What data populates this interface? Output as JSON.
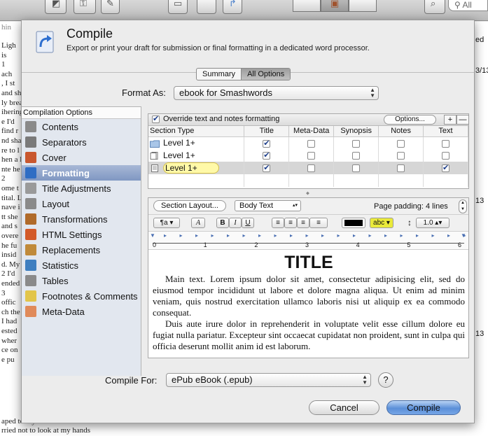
{
  "background": {
    "search_text": "All",
    "left_col_label": "hin",
    "left_lines": [
      "Ligh",
      "is",
      "1",
      "ach",
      ", I st",
      "and sh",
      "ly brea",
      "ihering",
      "e I'd",
      "find r",
      "nd sha",
      "re to l",
      "hen a l",
      "nte he",
      "2",
      "ome t",
      "tital. L",
      "nave i",
      "tt she",
      "and s",
      "overe",
      "he fu",
      "insid",
      "d. My",
      "2 I'd",
      "ended",
      "3",
      "offic",
      "ch the",
      "I had",
      "ested",
      "wher",
      "ce on",
      "e pu"
    ],
    "right_lines": [
      "ed",
      "3/13",
      "13",
      "13"
    ],
    "bottom_lines": [
      "aped to my face I didn't even know",
      "rried not to look at my hands"
    ]
  },
  "sheet": {
    "title": "Compile",
    "subtitle": "Export or print your draft for submission or final formatting in a dedicated word processor.",
    "mode_tabs": [
      {
        "label": "Summary",
        "selected": false
      },
      {
        "label": "All Options",
        "selected": true
      }
    ],
    "format_as_label": "Format As:",
    "format_as_value": "ebook for Smashwords"
  },
  "sidebar": {
    "header": "Compilation Options",
    "items": [
      {
        "label": "Contents",
        "icon": "list-icon",
        "color": "#8a8a8a"
      },
      {
        "label": "Separators",
        "icon": "separators-icon",
        "color": "#7a7a7a"
      },
      {
        "label": "Cover",
        "icon": "cover-icon",
        "color": "#c9572e"
      },
      {
        "label": "Formatting",
        "icon": "formatting-icon",
        "color": "#2f6dc4",
        "selected": true
      },
      {
        "label": "Title Adjustments",
        "icon": "title-adjust-icon",
        "color": "#9a9a9a"
      },
      {
        "label": "Layout",
        "icon": "layout-icon",
        "color": "#8a8a8a"
      },
      {
        "label": "Transformations",
        "icon": "transformations-icon",
        "color": "#b06a2a"
      },
      {
        "label": "HTML Settings",
        "icon": "html-icon",
        "color": "#d35a2a"
      },
      {
        "label": "Replacements",
        "icon": "replacements-icon",
        "color": "#c08a3a"
      },
      {
        "label": "Statistics",
        "icon": "statistics-icon",
        "color": "#3f7fc0"
      },
      {
        "label": "Tables",
        "icon": "tables-icon",
        "color": "#8a8a8a"
      },
      {
        "label": "Footnotes & Comments",
        "icon": "footnotes-icon",
        "color": "#e2c54a"
      },
      {
        "label": "Meta-Data",
        "icon": "tag-icon",
        "color": "#e08a5a"
      }
    ]
  },
  "options": {
    "override_label": "Override text and notes formatting",
    "override_checked": true,
    "options_button": "Options...",
    "plus_label": "+",
    "minus_label": "—",
    "columns": [
      "Section Type",
      "Title",
      "Meta-Data",
      "Synopsis",
      "Notes",
      "Text"
    ],
    "rows": [
      {
        "name": "Level  1+",
        "icon": "folder-icon",
        "title": true,
        "meta": false,
        "synopsis": false,
        "notes": false,
        "text": false,
        "selected": false
      },
      {
        "name": "Level  1+",
        "icon": "doc-stack-icon",
        "title": true,
        "meta": false,
        "synopsis": false,
        "notes": false,
        "text": false,
        "selected": false
      },
      {
        "name": "Level  1+",
        "icon": "document-icon",
        "title": true,
        "meta": false,
        "synopsis": false,
        "notes": false,
        "text": true,
        "selected": true
      }
    ]
  },
  "editor": {
    "section_layout_button": "Section Layout...",
    "style_popup": "Body Text",
    "page_padding": "Page padding: 4 lines",
    "paragraph_button": "¶a",
    "font_button": "A",
    "bold": "B",
    "italic": "I",
    "underline": "U",
    "highlight_label": "abc",
    "line_spacing": "1.0",
    "ruler_numbers": [
      "0",
      "1",
      "2",
      "3",
      "4",
      "5",
      "6"
    ],
    "doc_title": "TITLE",
    "paragraph1": "Main text. Lorem ipsum dolor sit amet, consectetur adipisicing elit, sed do eiusmod tempor incididunt ut labore et dolore magna aliqua. Ut enim ad minim veniam, quis nostrud exercitation ullamco laboris nisi ut aliquip ex ea commodo consequat.",
    "paragraph2": "Duis aute irure dolor in reprehenderit in voluptate velit esse cillum dolore eu fugiat nulla pariatur. Excepteur sint occaecat cupidatat non proident, sunt in culpa qui officia deserunt mollit anim id est laborum."
  },
  "footer": {
    "compile_for_label": "Compile For:",
    "compile_for_value": "ePub eBook (.epub)",
    "help": "?",
    "cancel": "Cancel",
    "compile": "Compile"
  },
  "colors": {
    "accent": "#5b8fd8",
    "sidebar_bg": "#e2e7ef",
    "selection": "#7f97c2"
  }
}
